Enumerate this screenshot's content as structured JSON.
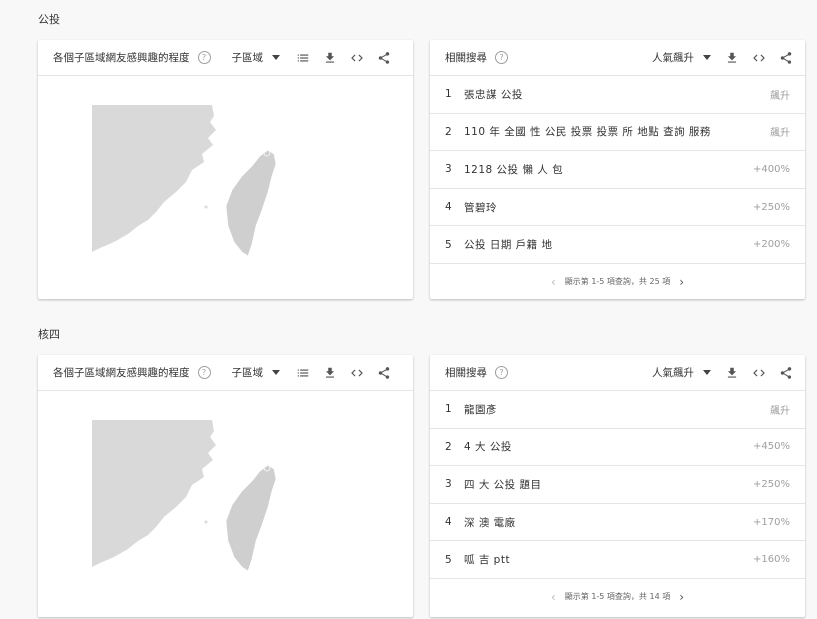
{
  "sections": [
    {
      "title": "公投",
      "map_card": {
        "title": "各個子區域網友感興趣的程度",
        "dropdown": "子區域"
      },
      "related_card": {
        "title": "相關搜尋",
        "dropdown": "人氣飆升",
        "rows": [
          {
            "idx": "1",
            "label": "張忠謀 公投",
            "value": "飆升"
          },
          {
            "idx": "2",
            "label": "110 年 全國 性 公民 投票 投票 所 地點 查詢 服務",
            "value": "飆升"
          },
          {
            "idx": "3",
            "label": "1218 公投 懶 人 包",
            "value": "+400%"
          },
          {
            "idx": "4",
            "label": "管碧玲",
            "value": "+250%"
          },
          {
            "idx": "5",
            "label": "公投 日期 戶籍 地",
            "value": "+200%"
          }
        ],
        "pager": "顯示第 1-5 項查詢，共 25 項"
      }
    },
    {
      "title": "核四",
      "map_card": {
        "title": "各個子區域網友感興趣的程度",
        "dropdown": "子區域"
      },
      "related_card": {
        "title": "相關搜尋",
        "dropdown": "人氣飆升",
        "rows": [
          {
            "idx": "1",
            "label": "龍園彥",
            "value": "飆升"
          },
          {
            "idx": "2",
            "label": "4 大 公投",
            "value": "+450%"
          },
          {
            "idx": "3",
            "label": "四 大 公投 題目",
            "value": "+250%"
          },
          {
            "idx": "4",
            "label": "深 澳 電廠",
            "value": "+170%"
          },
          {
            "idx": "5",
            "label": "呱 吉 ptt",
            "value": "+160%"
          }
        ],
        "pager": "顯示第 1-5 項查詢，共 14 項"
      }
    }
  ],
  "icons": {
    "help": "help-circle-icon",
    "list": "list-icon",
    "download": "download-icon",
    "embed": "code-embed-icon",
    "share": "share-icon",
    "prev": "chevron-left-icon",
    "next": "chevron-right-icon"
  },
  "colors": {
    "map_fill": "#d9d9d9",
    "taiwan_fill": "#cfcfcf"
  }
}
